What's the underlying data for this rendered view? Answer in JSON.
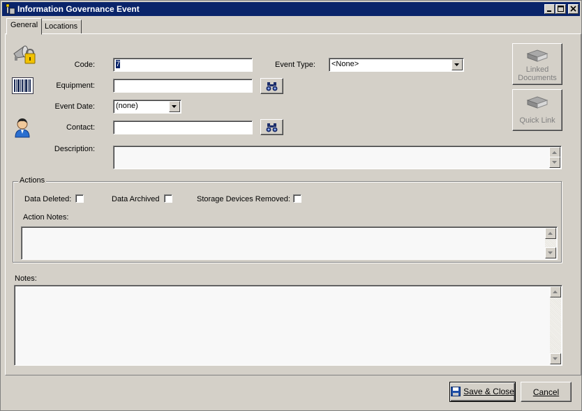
{
  "window": {
    "title": "Information Governance Event",
    "controls": {
      "minimize": "minimize",
      "maximize": "maximize",
      "close": "close"
    }
  },
  "tabs": [
    {
      "label": "General",
      "active": true
    },
    {
      "label": "Locations",
      "active": false
    }
  ],
  "form": {
    "code_label": "Code:",
    "code_value": "7",
    "event_type_label": "Event Type:",
    "event_type_value": "<None>",
    "equipment_label": "Equipment:",
    "equipment_value": "",
    "event_date_label": "Event Date:",
    "event_date_value": "(none)",
    "contact_label": "Contact:",
    "contact_value": "",
    "description_label": "Description:",
    "description_value": ""
  },
  "side_buttons": {
    "linked_documents_line1": "Linked",
    "linked_documents_line2": "Documents",
    "quick_link": "Quick Link"
  },
  "actions": {
    "legend": "Actions",
    "data_deleted_label": "Data Deleted:",
    "data_deleted_checked": false,
    "data_archived_label": "Data Archived",
    "data_archived_checked": false,
    "storage_removed_label": "Storage Devices Removed:",
    "storage_removed_checked": false,
    "action_notes_label": "Action Notes:",
    "action_notes_value": ""
  },
  "notes": {
    "label": "Notes:",
    "value": ""
  },
  "footer": {
    "save_close": "Save & Close",
    "cancel": "Cancel"
  },
  "icons": {
    "app": "info-pin-icon",
    "security": "lock-megaphone-icon",
    "barcode": "barcode-icon",
    "contact": "person-icon",
    "lookup": "binoculars-icon",
    "book": "book-icon",
    "save": "floppy-disk-icon"
  },
  "colors": {
    "titlebar": "#0a246a",
    "face": "#d4d0c8",
    "selection": "#0a246a"
  }
}
